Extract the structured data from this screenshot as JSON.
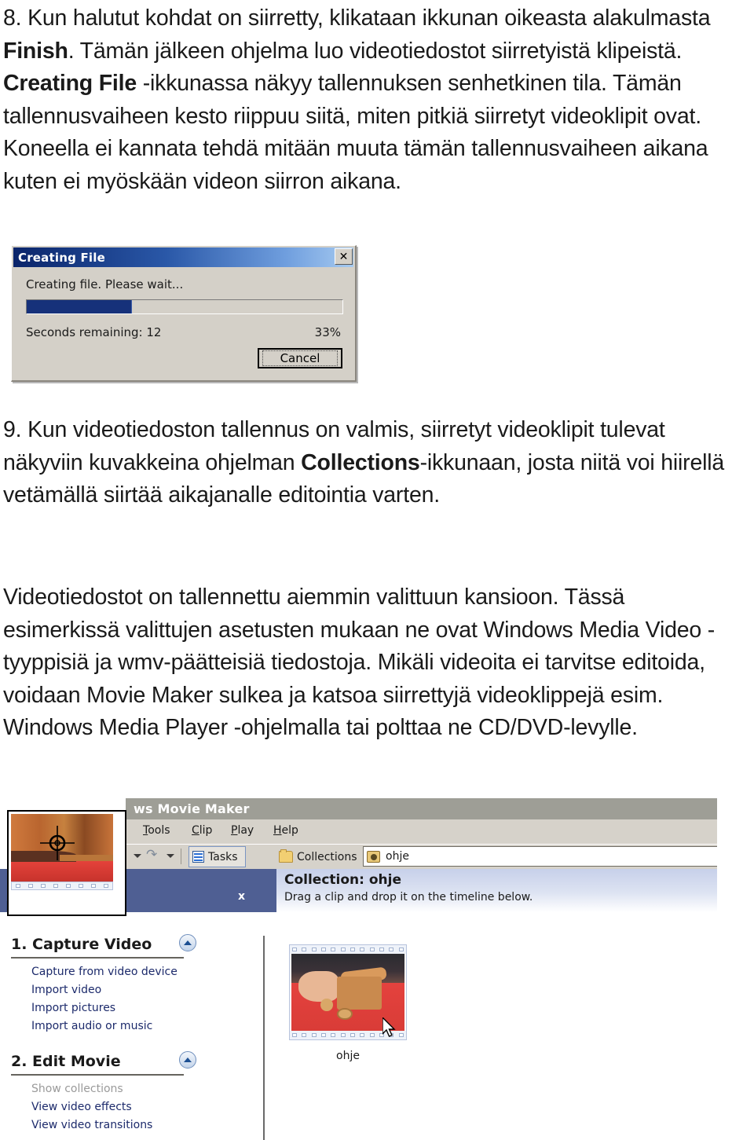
{
  "document": {
    "paragraphs": {
      "step8_before_bold1": "8. Kun halutut kohdat on siirretty, klikataan ikkunan oikeasta alakulmasta ",
      "step8_bold1": "Finish",
      "step8_middle": ". Tämän jälkeen ohjelma luo videotiedostot siirretyistä klipeistä. ",
      "step8_bold2": "Creating File",
      "step8_after": " -ikkunassa näkyy tallennuksen senhetkinen tila. Tämän tallennusvaiheen kesto riippuu siitä, miten pitkiä siirretyt videoklipit ovat. Koneella ei kannata tehdä mitään muuta tämän tallennusvaiheen aikana kuten ei myöskään videon siirron aikana.",
      "step9_before_bold": "9. Kun videotiedoston tallennus on valmis, siirretyt videoklipit tulevat näkyviin kuvakkeina ohjelman ",
      "step9_bold": "Collections",
      "step9_after": "-ikkunaan, josta niitä voi hiirellä vetämällä siirtää aikajanalle editointia varten.",
      "closing": "Videotiedostot on tallennettu aiemmin valittuun kansioon. Tässä esimerkissä valittujen asetusten mukaan ne ovat Windows Media Video -tyyppisiä ja wmv-päätteisiä tiedostoja. Mikäli videoita ei tarvitse editoida, voidaan Movie Maker sulkea ja katsoa siirrettyjä videoklippejä esim. Windows Media Player -ohjelmalla tai polttaa ne CD/DVD-levylle."
    }
  },
  "creating_file_dialog": {
    "title": "Creating File",
    "close_label": "✕",
    "status_text": "Creating file. Please wait...",
    "seconds_remaining_label": "Seconds remaining: 12",
    "percent_label": "33%",
    "progress_percent": 33,
    "cancel_label": "Cancel",
    "colors": {
      "titlebar_start": "#0a246a",
      "titlebar_end": "#a6caf0",
      "dialog_face": "#d4d0c8",
      "progress_fill": "#16317a"
    }
  },
  "movie_maker": {
    "window_title": "ws Movie Maker",
    "menus": [
      {
        "label": "Tools",
        "accel": "T"
      },
      {
        "label": "Clip",
        "accel": "C"
      },
      {
        "label": "Play",
        "accel": "P"
      },
      {
        "label": "Help",
        "accel": "H"
      }
    ],
    "toolbar": {
      "tasks_label": "Tasks",
      "collections_label": "Collections",
      "combo_value": "ohje"
    },
    "left_pane": {
      "close_label": "x"
    },
    "collection_header": {
      "title": "Collection: ohje",
      "subtitle": "Drag a clip and drop it on the timeline below."
    },
    "task_pane": {
      "section1_title": "1. Capture Video",
      "section1_links": [
        "Capture from video device",
        "Import video",
        "Import pictures",
        "Import audio or music"
      ],
      "section2_title": "2. Edit Movie",
      "section2_links": [
        "Show collections",
        "View video effects",
        "View video transitions"
      ],
      "disabled_links": [
        "Show collections"
      ]
    },
    "clip": {
      "label": "ohje"
    },
    "colors": {
      "titlebar": "#9e9e96",
      "chrome": "#d6d2ca",
      "left_pane": "#4f5f93",
      "link": "#1c2a6b"
    }
  }
}
